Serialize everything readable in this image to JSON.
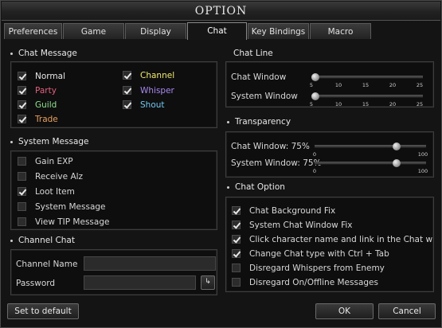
{
  "window": {
    "title": "OPTION"
  },
  "tabs": [
    {
      "label": "Preferences"
    },
    {
      "label": "Game"
    },
    {
      "label": "Display"
    },
    {
      "label": "Chat",
      "active": true
    },
    {
      "label": "Key Bindings"
    },
    {
      "label": "Macro"
    }
  ],
  "chat_message": {
    "title": "Chat Message",
    "items": [
      {
        "label": "Normal",
        "checked": true,
        "color": "#e8e8e8"
      },
      {
        "label": "Party",
        "checked": true,
        "color": "#e06080"
      },
      {
        "label": "Guild",
        "checked": true,
        "color": "#8fe08f"
      },
      {
        "label": "Trade",
        "checked": true,
        "color": "#e8a060"
      },
      {
        "label": "Channel",
        "checked": true,
        "color": "#f0e870"
      },
      {
        "label": "Whisper",
        "checked": true,
        "color": "#a888f0"
      },
      {
        "label": "Shout",
        "checked": true,
        "color": "#70c8f0"
      }
    ]
  },
  "system_message": {
    "title": "System Message",
    "items": [
      {
        "label": "Gain EXP",
        "checked": false
      },
      {
        "label": "Receive Alz",
        "checked": false
      },
      {
        "label": "Loot Item",
        "checked": true
      },
      {
        "label": "System Message",
        "checked": false
      },
      {
        "label": "View TIP Message",
        "checked": false
      }
    ]
  },
  "channel_chat": {
    "title": "Channel Chat",
    "channel_name_label": "Channel Name",
    "channel_name_value": "",
    "password_label": "Password",
    "password_value": ""
  },
  "chat_line": {
    "title": "Chat Line",
    "ticks": [
      "5",
      "10",
      "15",
      "20",
      "25"
    ],
    "sliders": [
      {
        "label": "Chat Window",
        "value": 5
      },
      {
        "label": "System Window",
        "value": 5
      }
    ]
  },
  "transparency": {
    "title": "Transparency",
    "min_label": "0",
    "max_label": "100",
    "sliders": [
      {
        "label": "Chat Window: 75%",
        "value": 75
      },
      {
        "label": "System Window: 75%",
        "value": 75
      }
    ]
  },
  "chat_option": {
    "title": "Chat Option",
    "items": [
      {
        "label": "Chat Background Fix",
        "checked": true
      },
      {
        "label": "System Chat Window Fix",
        "checked": true
      },
      {
        "label": "Click character name and link in the Chat window",
        "checked": true
      },
      {
        "label": "Change Chat type with Ctrl + Tab",
        "checked": true
      },
      {
        "label": "Disregard Whispers from Enemy",
        "checked": false
      },
      {
        "label": "Disregard On/Offline Messages",
        "checked": false
      }
    ]
  },
  "footer": {
    "default_label": "Set to default",
    "ok_label": "OK",
    "cancel_label": "Cancel"
  }
}
